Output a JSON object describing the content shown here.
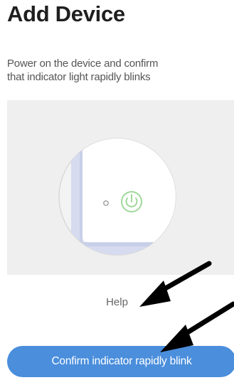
{
  "header": {
    "title": "Add Device"
  },
  "instruction": {
    "line1": "Power on the device and confirm",
    "line2": "that indicator light rapidly blinks"
  },
  "illustration": {
    "icons": [
      "device-illustration",
      "indicator-light-icon",
      "power-icon"
    ]
  },
  "help": {
    "label": "Help"
  },
  "confirm": {
    "label": "Confirm indicator rapidly blink"
  },
  "colors": {
    "button_bg": "#4a8edc",
    "button_text": "#ffffff",
    "panel_bg": "#efefef",
    "title": "#1f1f1f",
    "body_text": "#555555"
  }
}
